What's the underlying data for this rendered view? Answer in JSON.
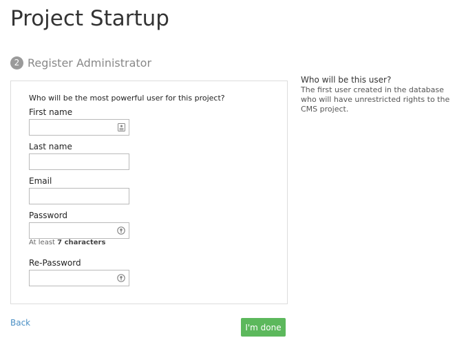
{
  "page": {
    "title": "Project Startup"
  },
  "step": {
    "number": "2",
    "title": "Register Administrator"
  },
  "form": {
    "question": "Who will be the most powerful user for this project?",
    "first_name_label": "First name",
    "first_name_value": "",
    "last_name_label": "Last name",
    "last_name_value": "",
    "email_label": "Email",
    "email_value": "",
    "password_label": "Password",
    "password_value": "",
    "password_hint_prefix": "At least ",
    "password_hint_bold": "7 characters",
    "repassword_label": "Re-Password",
    "repassword_value": ""
  },
  "sidebar": {
    "title": "Who will be this user?",
    "text": "The first user created in the database who will have unrestricted rights to the CMS project."
  },
  "actions": {
    "back_label": "Back",
    "done_label": "I'm done"
  },
  "icons": {
    "first_name_icon": "contact-card-icon",
    "password_icon": "password-key-icon",
    "repassword_icon": "password-key-icon"
  },
  "colors": {
    "done_button": "#5cb85c",
    "link": "#4a8fc4",
    "step_badge": "#9a9a9a"
  }
}
